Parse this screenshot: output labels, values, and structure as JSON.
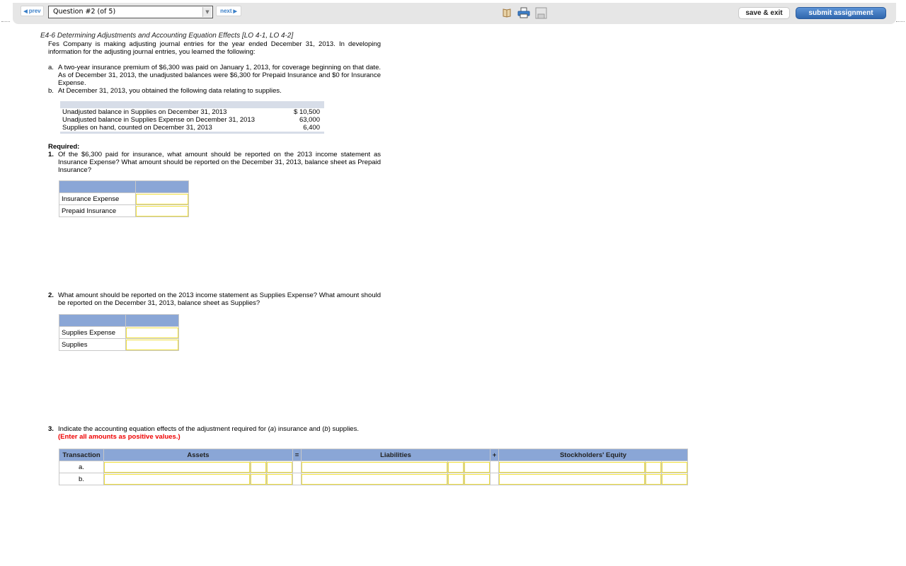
{
  "toolbar": {
    "prev_label": "prev",
    "next_label": "next",
    "question_select_value": "Question #2 (of 5)",
    "icons": [
      "reference-book-icon",
      "print-icon",
      "save-disk-icon"
    ],
    "save_exit_label": "save & exit",
    "submit_label": "submit assignment"
  },
  "problem": {
    "title": "E4-6 Determining Adjustments and Accounting Equation Effects [LO 4-1, LO 4-2]",
    "intro": "Fes Company is making adjusting journal entries for the year ended December 31, 2013. In developing information for the adjusting journal entries, you learned the following:",
    "items": [
      {
        "label": "a.",
        "text": "A two-year insurance premium of $6,300 was paid on January 1, 2013, for coverage beginning on that date. As of December 31, 2013, the unadjusted balances were $6,300 for Prepaid Insurance and $0 for Insurance Expense."
      },
      {
        "label": "b.",
        "text": "At December 31, 2013, you obtained the following data relating to supplies."
      }
    ],
    "supplies_table": [
      {
        "desc": "Unadjusted balance in Supplies on December 31, 2013",
        "value": "$ 10,500"
      },
      {
        "desc": "Unadjusted balance in Supplies Expense on December 31, 2013",
        "value": "63,000"
      },
      {
        "desc": "Supplies on hand, counted on December 31, 2013",
        "value": "6,400"
      }
    ]
  },
  "required": {
    "label": "Required:",
    "q1": {
      "num": "1.",
      "text": "Of the $6,300 paid for insurance, what amount should be reported on the 2013 income statement as Insurance Expense? What amount should be reported on the December 31, 2013, balance sheet as Prepaid Insurance?",
      "rows": [
        {
          "label": "Insurance Expense",
          "value": ""
        },
        {
          "label": "Prepaid Insurance",
          "value": ""
        }
      ]
    },
    "q2": {
      "num": "2.",
      "text": "What amount should be reported on the 2013 income statement as Supplies Expense? What amount should be reported on the December 31, 2013, balance sheet as Supplies?",
      "rows": [
        {
          "label": "Supplies Expense",
          "value": ""
        },
        {
          "label": "Supplies",
          "value": ""
        }
      ]
    },
    "q3": {
      "num": "3.",
      "text_pre": "Indicate the accounting equation effects of the adjustment required for (",
      "text_a": "a",
      "text_mid": ") insurance and (",
      "text_b": "b",
      "text_post": ") supplies.",
      "note": "(Enter all amounts as positive values.)",
      "headers": {
        "transaction": "Transaction",
        "assets": "Assets",
        "equals": "=",
        "liabilities": "Liabilities",
        "plus": "+",
        "equity": "Stockholders' Equity"
      },
      "rows": [
        {
          "label": "a."
        },
        {
          "label": "b."
        }
      ]
    }
  }
}
